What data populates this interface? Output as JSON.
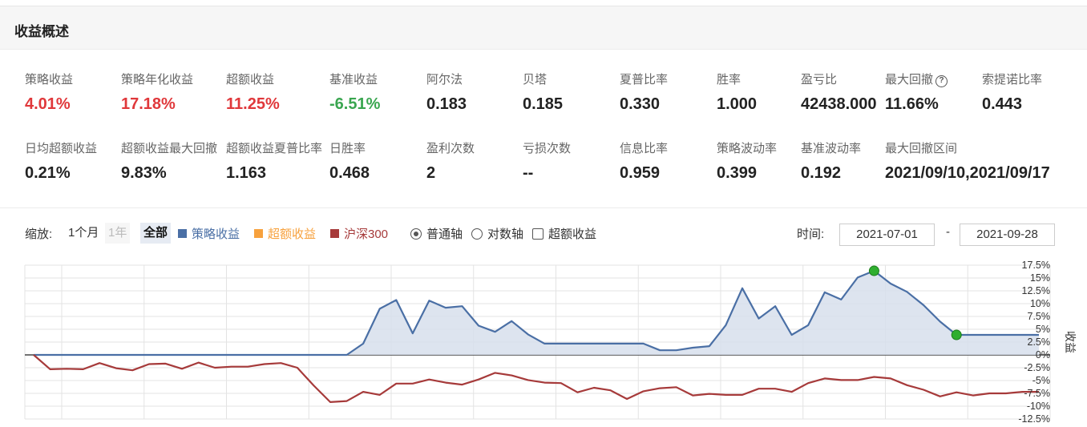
{
  "header": {
    "title": "收益概述"
  },
  "metrics_row1": [
    {
      "label": "策略收益",
      "value": "4.01%",
      "tone": "red"
    },
    {
      "label": "策略年化收益",
      "value": "17.18%",
      "tone": "red"
    },
    {
      "label": "超额收益",
      "value": "11.25%",
      "tone": "red"
    },
    {
      "label": "基准收益",
      "value": "-6.51%",
      "tone": "green"
    },
    {
      "label": "阿尔法",
      "value": "0.183",
      "tone": ""
    },
    {
      "label": "贝塔",
      "value": "0.185",
      "tone": ""
    },
    {
      "label": "夏普比率",
      "value": "0.330",
      "tone": ""
    },
    {
      "label": "胜率",
      "value": "1.000",
      "tone": ""
    },
    {
      "label": "盈亏比",
      "value": "42438.000",
      "tone": ""
    },
    {
      "label": "最大回撤",
      "value": "11.66%",
      "tone": ""
    },
    {
      "label": "索提诺比率",
      "value": "0.443",
      "tone": ""
    }
  ],
  "metrics_row2": [
    {
      "label": "日均超额收益",
      "value": "0.21%"
    },
    {
      "label": "超额收益最大回撤",
      "value": "9.83%"
    },
    {
      "label": "超额收益夏普比率",
      "value": "1.163"
    },
    {
      "label": "日胜率",
      "value": "0.468"
    },
    {
      "label": "盈利次数",
      "value": "2"
    },
    {
      "label": "亏损次数",
      "value": "--"
    },
    {
      "label": "信息比率",
      "value": "0.959"
    },
    {
      "label": "策略波动率",
      "value": "0.399"
    },
    {
      "label": "基准波动率",
      "value": "0.192"
    },
    {
      "label": "最大回撤区间",
      "value": "2021/09/10,2021/09/17"
    }
  ],
  "help_icon": {
    "glyph": "?",
    "icon": "question-circle-icon"
  },
  "controls": {
    "zoom_label": "缩放:",
    "zoom_options": [
      "1个月",
      "1年",
      "全部"
    ],
    "zoom_active": "全部",
    "legend": [
      {
        "label": "策略收益",
        "color": "#4a6fa5"
      },
      {
        "label": "超额收益",
        "color": "#f7a13d"
      },
      {
        "label": "沪深300",
        "color": "#a63a3a"
      }
    ],
    "axis_options": [
      "普通轴",
      "对数轴"
    ],
    "axis_selected": "普通轴",
    "excess_checkbox_label": "超额收益",
    "time_label": "时间:",
    "start_date": "2021-07-01",
    "separator": "-",
    "end_date": "2021-09-28"
  },
  "chart_data": {
    "type": "line",
    "ylabel": "收益",
    "ylim": [
      -12.5,
      17.5
    ],
    "yticks": [
      "17.5%",
      "15%",
      "12.5%",
      "10%",
      "7.5%",
      "5%",
      "2.5%",
      "0%",
      "-2.5%",
      "-5%",
      "-7.5%",
      "-10%",
      "-12.5%"
    ],
    "ytick_values": [
      17.5,
      15,
      12.5,
      10,
      7.5,
      5,
      2.5,
      0,
      -2.5,
      -5,
      -7.5,
      -10,
      -12.5
    ],
    "grid": true,
    "series": [
      {
        "name": "策略收益",
        "color": "#4a6fa5",
        "fill": "#d7dfec",
        "values": [
          0,
          0,
          0,
          0,
          0,
          0,
          0,
          0,
          0,
          0,
          0,
          0,
          0,
          0,
          0,
          0,
          0,
          0,
          0,
          0,
          2.2,
          9,
          10.7,
          4.2,
          10.6,
          9.2,
          9.5,
          5.7,
          4.5,
          6.6,
          4,
          2.2,
          2.2,
          2.2,
          2.2,
          2.2,
          2.2,
          2.2,
          0.9,
          0.9,
          1.4,
          1.7,
          5.8,
          13,
          7.1,
          9.5,
          3.9,
          5.8,
          12.2,
          10.8,
          15.1,
          16.4,
          13.9,
          12.3,
          9.7,
          6.5,
          3.9,
          3.9,
          3.9,
          3.9,
          3.9,
          3.9
        ]
      },
      {
        "name": "沪深300",
        "color": "#a63a3a",
        "values": [
          0,
          -2.8,
          -2.7,
          -2.8,
          -1.6,
          -2.6,
          -3,
          -1.8,
          -1.7,
          -2.7,
          -1.5,
          -2.5,
          -2.3,
          -2.3,
          -1.8,
          -1.6,
          -2.5,
          -6,
          -9.2,
          -9,
          -7.2,
          -7.8,
          -5.6,
          -5.6,
          -4.8,
          -5.4,
          -5.8,
          -4.8,
          -3.5,
          -4,
          -4.9,
          -5.4,
          -5.5,
          -7.3,
          -6.4,
          -6.9,
          -8.6,
          -7.1,
          -6.5,
          -6.3,
          -7.9,
          -7.6,
          -7.8,
          -7.8,
          -6.6,
          -6.6,
          -7.2,
          -5.5,
          -4.6,
          -4.9,
          -4.9,
          -4.3,
          -4.6,
          -5.9,
          -6.8,
          -8.1,
          -7.3,
          -7.9,
          -7.5,
          -7.5,
          -7.2,
          -7.2
        ]
      }
    ],
    "markers": [
      {
        "series": 0,
        "index": 51,
        "color": "#2fae2f"
      },
      {
        "series": 0,
        "index": 56,
        "color": "#2fae2f"
      }
    ]
  }
}
